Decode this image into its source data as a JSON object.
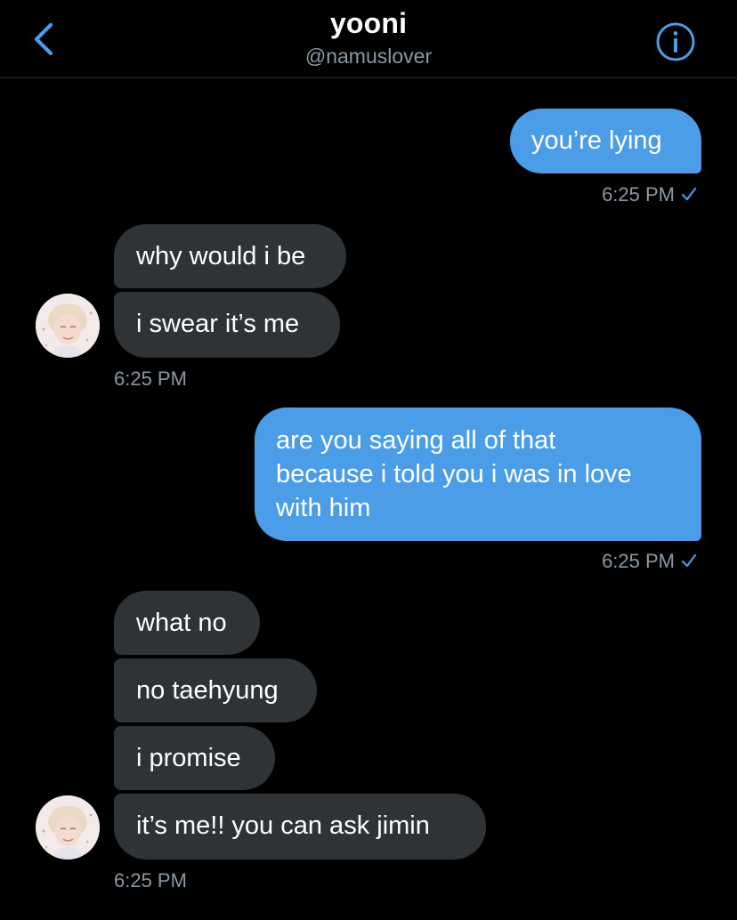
{
  "header": {
    "title": "yooni",
    "handle": "@namuslover",
    "back_icon": "chevron-left-icon",
    "info_icon": "info-circle-icon",
    "accent": "#4a9de6"
  },
  "colors": {
    "outgoing_bubble": "#4a9de6",
    "incoming_bubble": "#2f3336",
    "timestamp": "#8b98a5",
    "background": "#000000"
  },
  "messages": [
    {
      "dir": "out",
      "text": "you’re lying"
    },
    {
      "dir": "in",
      "text": "why would i be"
    },
    {
      "dir": "in",
      "text": "i swear it’s me"
    },
    {
      "dir": "out",
      "lines": [
        "are you saying all of that",
        "because i told you i was in love",
        "with him"
      ]
    },
    {
      "dir": "in",
      "text": "what no"
    },
    {
      "dir": "in",
      "text": "no taehyung"
    },
    {
      "dir": "in",
      "text": "i promise"
    },
    {
      "dir": "in",
      "text": "it’s me!! you can ask jimin"
    }
  ],
  "timestamps": [
    "6:25 PM",
    "6:25 PM",
    "6:25 PM",
    "6:25 PM"
  ]
}
